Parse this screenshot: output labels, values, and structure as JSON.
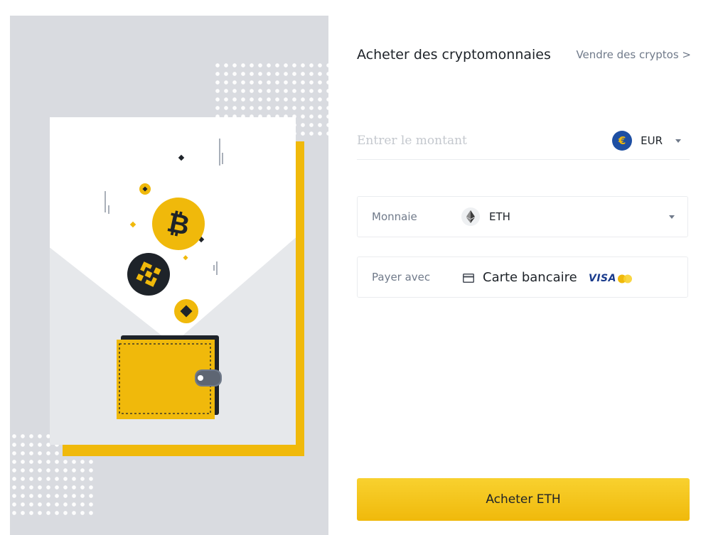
{
  "header": {
    "title": "Acheter des cryptomonnaies",
    "sell_link": "Vendre des cryptos >"
  },
  "amount": {
    "placeholder": "Entrer le montant",
    "value": "",
    "currency": {
      "code": "EUR",
      "icon": "euro-icon",
      "symbol": "€"
    }
  },
  "coin": {
    "label": "Monnaie",
    "code": "ETH",
    "icon": "ethereum-icon"
  },
  "payment": {
    "label": "Payer avec",
    "method": "Carte bancaire",
    "icon": "credit-card-icon",
    "brands": {
      "visa": "VISA",
      "mastercard_icon": "mastercard-icon"
    }
  },
  "buy_button": {
    "label": "Acheter ETH"
  },
  "illustration": {
    "bitcoin_icon": "bitcoin-icon",
    "binance_icon": "binance-icon",
    "wallet_icon": "wallet-icon"
  },
  "colors": {
    "accent": "#f0b90b",
    "accent_light": "#f8d12f",
    "text_primary": "#1e2329",
    "text_secondary": "#707a8a",
    "border": "#eaecef",
    "left_panel_bg": "#d9dbe0",
    "visa_blue": "#1a3b8c",
    "euro_blue": "#1e4fa3"
  }
}
